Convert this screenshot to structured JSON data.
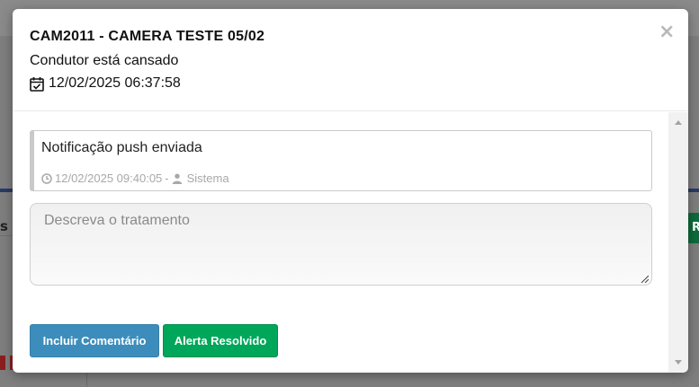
{
  "background": {
    "left_fragment": "s A",
    "right_fragment": "R"
  },
  "modal": {
    "title": "CAM2011 - CAMERA TESTE 05/02",
    "subtitle": "Condutor está cansado",
    "datetime": "12/02/2025 06:37:58",
    "close_label": "×"
  },
  "note": {
    "text": "Notificação push enviada",
    "timestamp": "12/02/2025 09:40:05",
    "separator": "-",
    "author": "Sistema"
  },
  "comment": {
    "placeholder": "Descreva o tratamento",
    "value": ""
  },
  "buttons": {
    "comment_label": "Incluir Comentário",
    "resolve_label": "Alerta Resolvido"
  },
  "colors": {
    "primary": "#3c8dbc",
    "success": "#00a65a",
    "muted": "#a8a8a8"
  },
  "icons": {
    "date": "calendar-check-icon",
    "time": "clock-icon",
    "user": "user-icon",
    "close": "close-icon"
  }
}
